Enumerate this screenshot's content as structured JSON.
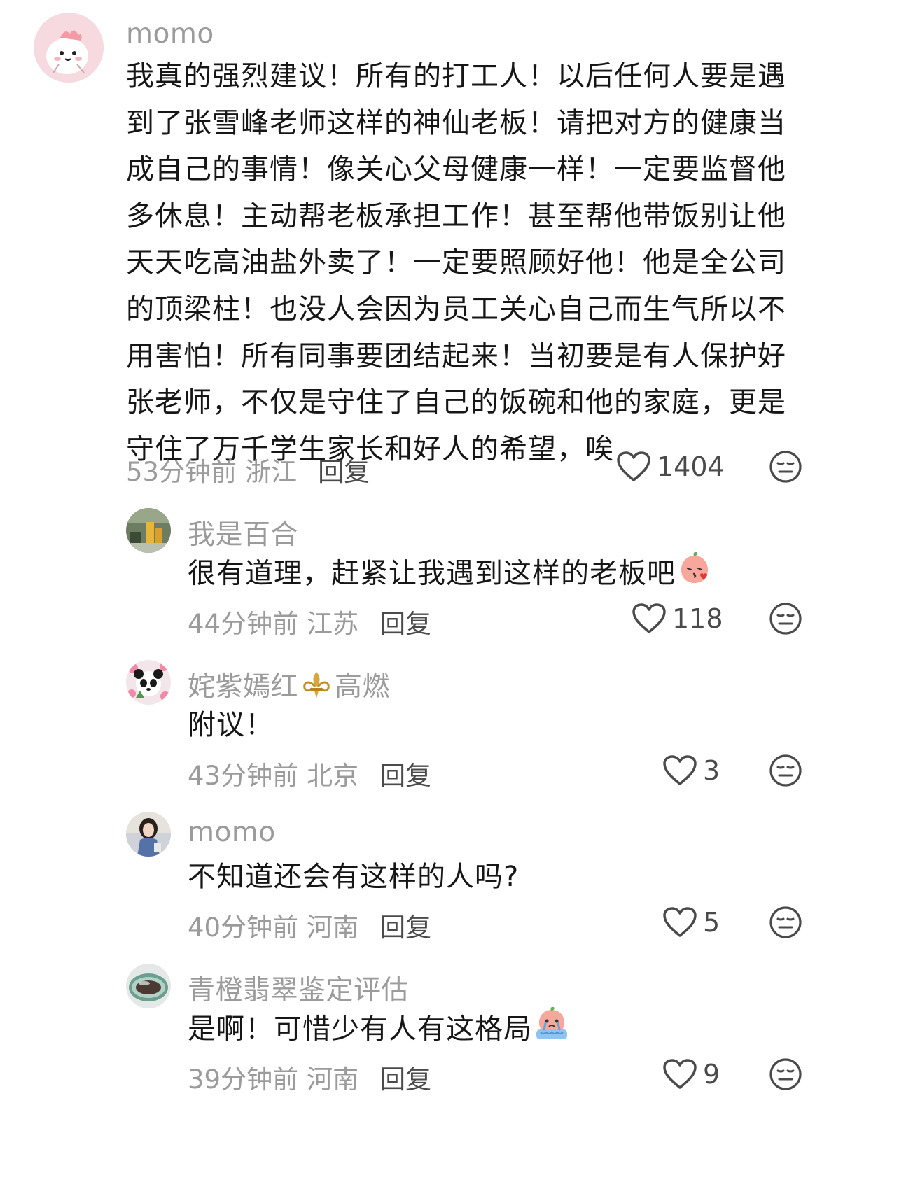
{
  "comments": [
    {
      "username": "momo",
      "content": "我真的强烈建议！所有的打工人！以后任何人要是遇到了张雪峰老师这样的神仙老板！请把对方的健康当成自己的事情！像关心父母健康一样！一定要监督他多休息！主动帮老板承担工作！甚至帮他带饭别让他天天吃高油盐外卖了！一定要照顾好他！他是全公司的顶梁柱！也没人会因为员工关心自己而生气所以不用害怕！所有同事要团结起来！当初要是有人保护好张老师，不仅是守住了自己的饭碗和他的家庭，更是守住了万千学生家长和好人的希望，唉",
      "time": "53分钟前",
      "location": "浙江",
      "reply": "回复",
      "likes": "1404"
    },
    {
      "username": "我是百合",
      "content": "很有道理，赶紧让我遇到这样的老板吧",
      "time": "44分钟前",
      "location": "江苏",
      "reply": "回复",
      "likes": "118"
    },
    {
      "username_part1": "姹紫嫣红",
      "username_part2": "高燃",
      "content": "附议！",
      "time": "43分钟前",
      "location": "北京",
      "reply": "回复",
      "likes": "3"
    },
    {
      "username": "momo",
      "content": "不知道还会有这样的人吗?",
      "time": "40分钟前",
      "location": "河南",
      "reply": "回复",
      "likes": "5"
    },
    {
      "username": "青橙翡翠鉴定评估",
      "content": "是啊！可惜少有人有这格局",
      "time": "39分钟前",
      "location": "河南",
      "reply": "回复",
      "likes": "9"
    }
  ],
  "icons": {
    "like": "heart-outline-icon",
    "dislike": "meh-face-icon",
    "emoji_kiss": "peach-kiss-emoji",
    "emoji_cry": "peach-cry-emoji",
    "badge": "fleur-de-lis-badge"
  },
  "colors": {
    "text": "#161616",
    "meta": "#9b9b9b",
    "icon": "#4a4a4a"
  }
}
